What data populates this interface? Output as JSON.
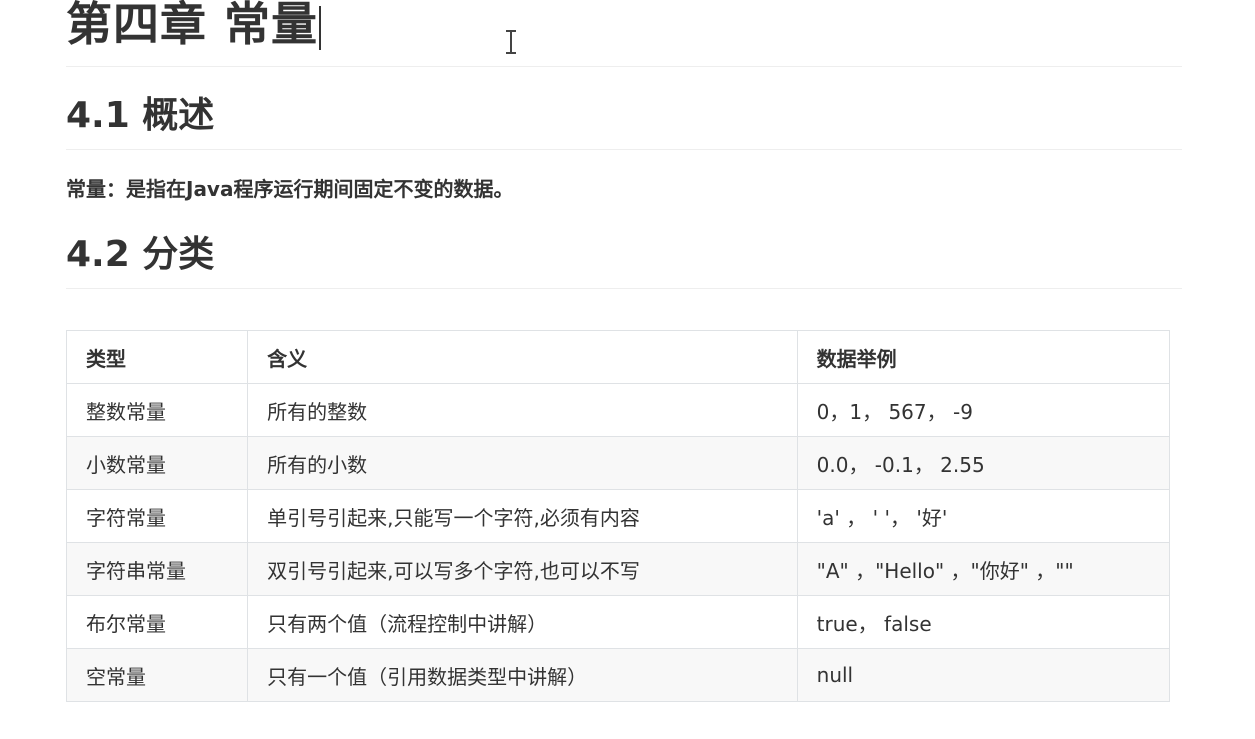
{
  "heading": {
    "title": "第四章 常量"
  },
  "section1": {
    "title": "4.1 概述",
    "text": "常量：是指在Java程序运行期间固定不变的数据。"
  },
  "section2": {
    "title": "4.2 分类"
  },
  "table": {
    "headers": [
      "类型",
      "含义",
      "数据举例"
    ],
    "rows": [
      [
        "整数常量",
        "所有的整数",
        "0，1， 567， -9"
      ],
      [
        "小数常量",
        "所有的小数",
        "0.0， -0.1， 2.55"
      ],
      [
        "字符常量",
        "单引号引起来,只能写一个字符,必须有内容",
        "'a' ， ' '， '好'"
      ],
      [
        "字符串常量",
        "双引号引起来,可以写多个字符,也可以不写",
        "\"A\" ，\"Hello\" ，\"你好\" ，\"\""
      ],
      [
        "布尔常量",
        "只有两个值（流程控制中讲解）",
        "true， false"
      ],
      [
        "空常量",
        "只有一个值（引用数据类型中讲解）",
        "null"
      ]
    ]
  }
}
